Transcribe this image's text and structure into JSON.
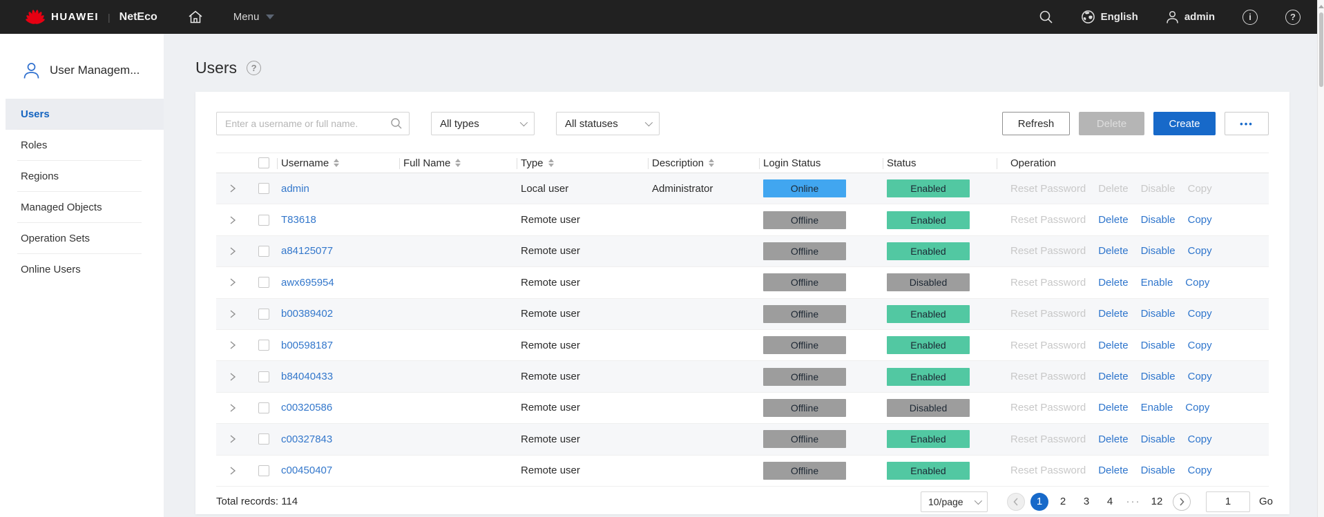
{
  "topbar": {
    "brand": "HUAWEI",
    "divider": "|",
    "product": "NetEco",
    "menu_label": "Menu",
    "language": "English",
    "username": "admin"
  },
  "sidebar": {
    "title": "User Managem...",
    "items": [
      {
        "label": "Users",
        "active": true
      },
      {
        "label": "Roles",
        "active": false
      },
      {
        "label": "Regions",
        "active": false
      },
      {
        "label": "Managed Objects",
        "active": false
      },
      {
        "label": "Operation Sets",
        "active": false
      },
      {
        "label": "Online Users",
        "active": false
      }
    ]
  },
  "page": {
    "title": "Users"
  },
  "toolbar": {
    "search_placeholder": "Enter a username or full name.",
    "type_filter_value": "All types",
    "status_filter_value": "All statuses",
    "refresh_label": "Refresh",
    "delete_label": "Delete",
    "create_label": "Create",
    "more_label": "•••"
  },
  "table": {
    "columns": [
      {
        "label": "Username",
        "sortable": true
      },
      {
        "label": "Full Name",
        "sortable": true
      },
      {
        "label": "Type",
        "sortable": true
      },
      {
        "label": "Description",
        "sortable": true
      },
      {
        "label": "Login Status",
        "sortable": false
      },
      {
        "label": "Status",
        "sortable": false
      },
      {
        "label": "Operation",
        "sortable": false
      }
    ],
    "rows": [
      {
        "username": "admin",
        "full_name": "",
        "type": "Local user",
        "description": "Administrator",
        "login_status": "Online",
        "status": "Enabled",
        "operations": [
          {
            "label": "Reset Password",
            "enabled": false
          },
          {
            "label": "Delete",
            "enabled": false
          },
          {
            "label": "Disable",
            "enabled": false
          },
          {
            "label": "Copy",
            "enabled": false
          }
        ]
      },
      {
        "username": "T83618",
        "full_name": "",
        "type": "Remote user",
        "description": "",
        "login_status": "Offline",
        "status": "Enabled",
        "operations": [
          {
            "label": "Reset Password",
            "enabled": false
          },
          {
            "label": "Delete",
            "enabled": true
          },
          {
            "label": "Disable",
            "enabled": true
          },
          {
            "label": "Copy",
            "enabled": true
          }
        ]
      },
      {
        "username": "a84125077",
        "full_name": "",
        "type": "Remote user",
        "description": "",
        "login_status": "Offline",
        "status": "Enabled",
        "operations": [
          {
            "label": "Reset Password",
            "enabled": false
          },
          {
            "label": "Delete",
            "enabled": true
          },
          {
            "label": "Disable",
            "enabled": true
          },
          {
            "label": "Copy",
            "enabled": true
          }
        ]
      },
      {
        "username": "awx695954",
        "full_name": "",
        "type": "Remote user",
        "description": "",
        "login_status": "Offline",
        "status": "Disabled",
        "operations": [
          {
            "label": "Reset Password",
            "enabled": false
          },
          {
            "label": "Delete",
            "enabled": true
          },
          {
            "label": "Enable",
            "enabled": true
          },
          {
            "label": "Copy",
            "enabled": true
          }
        ]
      },
      {
        "username": "b00389402",
        "full_name": "",
        "type": "Remote user",
        "description": "",
        "login_status": "Offline",
        "status": "Enabled",
        "operations": [
          {
            "label": "Reset Password",
            "enabled": false
          },
          {
            "label": "Delete",
            "enabled": true
          },
          {
            "label": "Disable",
            "enabled": true
          },
          {
            "label": "Copy",
            "enabled": true
          }
        ]
      },
      {
        "username": "b00598187",
        "full_name": "",
        "type": "Remote user",
        "description": "",
        "login_status": "Offline",
        "status": "Enabled",
        "operations": [
          {
            "label": "Reset Password",
            "enabled": false
          },
          {
            "label": "Delete",
            "enabled": true
          },
          {
            "label": "Disable",
            "enabled": true
          },
          {
            "label": "Copy",
            "enabled": true
          }
        ]
      },
      {
        "username": "b84040433",
        "full_name": "",
        "type": "Remote user",
        "description": "",
        "login_status": "Offline",
        "status": "Enabled",
        "operations": [
          {
            "label": "Reset Password",
            "enabled": false
          },
          {
            "label": "Delete",
            "enabled": true
          },
          {
            "label": "Disable",
            "enabled": true
          },
          {
            "label": "Copy",
            "enabled": true
          }
        ]
      },
      {
        "username": "c00320586",
        "full_name": "",
        "type": "Remote user",
        "description": "",
        "login_status": "Offline",
        "status": "Disabled",
        "operations": [
          {
            "label": "Reset Password",
            "enabled": false
          },
          {
            "label": "Delete",
            "enabled": true
          },
          {
            "label": "Enable",
            "enabled": true
          },
          {
            "label": "Copy",
            "enabled": true
          }
        ]
      },
      {
        "username": "c00327843",
        "full_name": "",
        "type": "Remote user",
        "description": "",
        "login_status": "Offline",
        "status": "Enabled",
        "operations": [
          {
            "label": "Reset Password",
            "enabled": false
          },
          {
            "label": "Delete",
            "enabled": true
          },
          {
            "label": "Disable",
            "enabled": true
          },
          {
            "label": "Copy",
            "enabled": true
          }
        ]
      },
      {
        "username": "c00450407",
        "full_name": "",
        "type": "Remote user",
        "description": "",
        "login_status": "Offline",
        "status": "Enabled",
        "operations": [
          {
            "label": "Reset Password",
            "enabled": false
          },
          {
            "label": "Delete",
            "enabled": true
          },
          {
            "label": "Disable",
            "enabled": true
          },
          {
            "label": "Copy",
            "enabled": true
          }
        ]
      }
    ]
  },
  "footer": {
    "total_label": "Total records: 114",
    "page_size": "10/page",
    "pages": {
      "active": "1",
      "p2": "2",
      "p3": "3",
      "p4": "4",
      "ellipsis": "···",
      "last": "12"
    },
    "goto_value": "1",
    "go_label": "Go"
  },
  "colors": {
    "topbar_bg": "#212121",
    "huawei_red": "#e60012",
    "accent_blue": "#1769c9",
    "link_blue": "#3377cb",
    "badge_online": "#41a6f0",
    "badge_offline": "#9d9d9d",
    "badge_enabled": "#52c8a2",
    "badge_disabled": "#9d9d9d",
    "content_bg": "#eef0f3",
    "sidebar_active_bg": "#ebedf1"
  }
}
